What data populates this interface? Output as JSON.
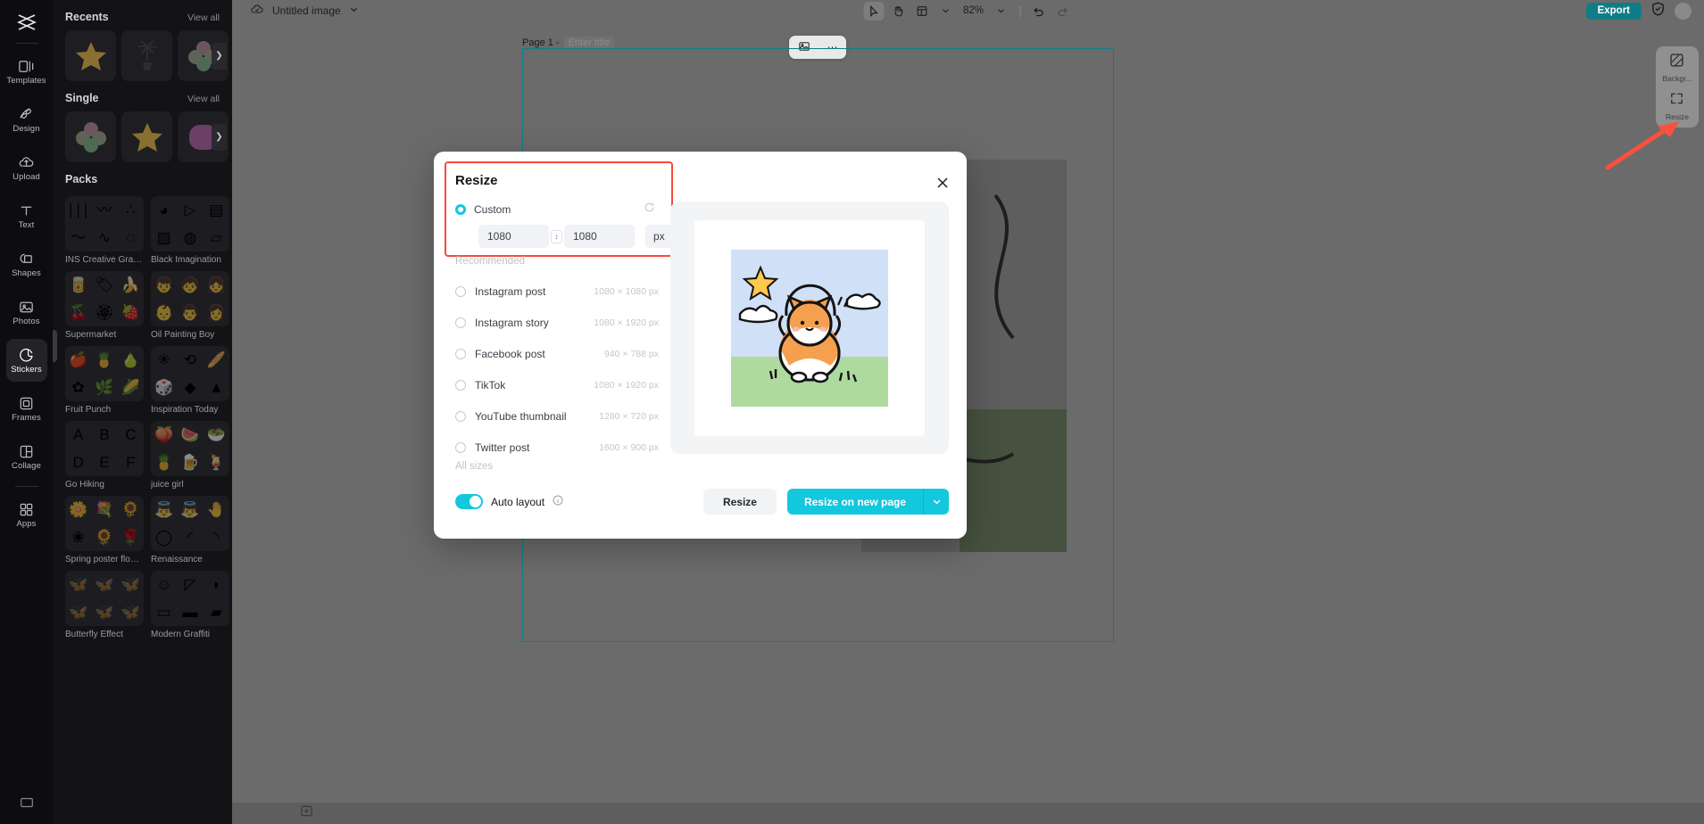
{
  "rail": {
    "logo_icon": "capcut-logo-icon",
    "items": [
      {
        "label": "Templates",
        "icon": "templates-icon",
        "active": false
      },
      {
        "label": "Design",
        "icon": "design-icon",
        "active": false
      },
      {
        "label": "Upload",
        "icon": "upload-cloud-icon",
        "active": false
      },
      {
        "label": "Text",
        "icon": "text-icon",
        "active": false
      },
      {
        "label": "Shapes",
        "icon": "shapes-icon",
        "active": false
      },
      {
        "label": "Photos",
        "icon": "photos-icon",
        "active": false
      },
      {
        "label": "Stickers",
        "icon": "stickers-icon",
        "active": true
      },
      {
        "label": "Frames",
        "icon": "frames-icon",
        "active": false
      },
      {
        "label": "Collage",
        "icon": "collage-icon",
        "active": false
      },
      {
        "label": "Apps",
        "icon": "apps-grid-icon",
        "active": false
      }
    ]
  },
  "panel": {
    "sections": [
      {
        "title": "Recents",
        "view_all": "View all"
      },
      {
        "title": "Single",
        "view_all": "View all"
      },
      {
        "title": "Packs",
        "view_all": ""
      }
    ],
    "recents_tiles": [
      "star-sticker",
      "plant-sticker",
      "clover-sticker"
    ],
    "single_tiles": [
      "clover-sticker",
      "star-sticker",
      "gradient-blob-sticker"
    ],
    "packs": [
      {
        "name": "INS Creative Graphics",
        "glyphs": [
          "∣∣∣",
          "〰",
          "∴",
          "〜",
          "∿",
          "◌"
        ]
      },
      {
        "name": "Black Imagination",
        "glyphs": [
          "◕",
          "▷",
          "▤",
          "▨",
          "◍",
          "▱"
        ]
      },
      {
        "name": "Supermarket",
        "glyphs": [
          "🥫",
          "🏷",
          "🍌",
          "🍒",
          "🏵",
          "🍓"
        ]
      },
      {
        "name": "Oil Painting Boy",
        "glyphs": [
          "👦",
          "🧒",
          "👧",
          "👶",
          "👨",
          "👩"
        ]
      },
      {
        "name": "Fruit Punch",
        "glyphs": [
          "🍎",
          "🍍",
          "🍐",
          "✿",
          "🌿",
          "🌽"
        ]
      },
      {
        "name": "Inspiration Today",
        "glyphs": [
          "✳",
          "⟲",
          "🥖",
          "🎲",
          "◆",
          "▲"
        ]
      },
      {
        "name": "Go Hiking",
        "glyphs": [
          "A",
          "B",
          "C",
          "D",
          "E",
          "F"
        ]
      },
      {
        "name": "juice girl",
        "glyphs": [
          "🍑",
          "🍉",
          "🥗",
          "🍍",
          "🍺",
          "🍹"
        ]
      },
      {
        "name": "Spring poster flowers",
        "glyphs": [
          "🌼",
          "💐",
          "🌻",
          "❀",
          "🌻",
          "🌹"
        ]
      },
      {
        "name": "Renaissance",
        "glyphs": [
          "👼",
          "👼",
          "🤚",
          "◯",
          "◜",
          "◝"
        ]
      },
      {
        "name": "Butterfly Effect",
        "glyphs": [
          "🦋",
          "🦋",
          "🦋",
          "🦋",
          "🦋",
          "🦋"
        ]
      },
      {
        "name": "Modern Graffiti",
        "glyphs": [
          "☺",
          "◸",
          "◗",
          "▭",
          "▬",
          "▰"
        ]
      }
    ]
  },
  "topbar": {
    "cloud_icon": "cloud-saved-icon",
    "doc_title": "Untitled image",
    "doc_caret_icon": "chevron-down-icon",
    "select_icon": "cursor-select-icon",
    "hand_icon": "hand-pan-icon",
    "layout_icon": "layout-grid-icon",
    "layout_caret_icon": "chevron-down-icon",
    "zoom_value": "82%",
    "zoom_caret_icon": "chevron-down-icon",
    "undo_icon": "undo-icon",
    "redo_icon": "redo-icon",
    "export_label": "Export",
    "shield_icon": "shield-check-icon",
    "avatar_icon": "avatar"
  },
  "canvas": {
    "page_number": "Page 1 -",
    "page_title_placeholder": "Enter title",
    "float_crop_icon": "crop-image-icon",
    "float_more_icon": "more-options-icon"
  },
  "right_tools": [
    {
      "label": "Backgr...",
      "icon": "background-icon"
    },
    {
      "label": "Resize",
      "icon": "resize-icon"
    }
  ],
  "bottombar": {
    "add_page_icon": "add-page-icon"
  },
  "modal": {
    "title": "Resize",
    "close_icon": "close-icon",
    "custom_label": "Custom",
    "custom_selected": true,
    "reset_icon": "reset-icon",
    "width_value": "1080",
    "height_value": "1080",
    "link_icon": "link-ratio-icon",
    "unit_value": "px",
    "unit_caret_icon": "chevron-down-icon",
    "recommended_label": "Recommended",
    "all_sizes_label": "All sizes",
    "options": [
      {
        "name": "Instagram post",
        "dim": "1080 × 1080 px",
        "selected": false
      },
      {
        "name": "Instagram story",
        "dim": "1080 × 1920 px",
        "selected": false
      },
      {
        "name": "Facebook post",
        "dim": "940 × 788 px",
        "selected": false
      },
      {
        "name": "TikTok",
        "dim": "1080 × 1920 px",
        "selected": false
      },
      {
        "name": "YouTube thumbnail",
        "dim": "1280 × 720 px",
        "selected": false
      },
      {
        "name": "Twitter post",
        "dim": "1600 × 900 px",
        "selected": false
      }
    ],
    "auto_layout_label": "Auto layout",
    "auto_layout_on": true,
    "info_icon": "info-icon",
    "resize_label": "Resize",
    "resize_new_page_label": "Resize on new page",
    "primary_caret_icon": "chevron-down-icon"
  },
  "colors": {
    "accent": "#13c7dd",
    "highlight": "#f94a3d",
    "export": "#0f7d87",
    "canvas_border": "#0f7d87",
    "rail_bg": "#0d0d0f",
    "panel_bg": "#131316",
    "editor_bg": "#6b6b6b"
  }
}
